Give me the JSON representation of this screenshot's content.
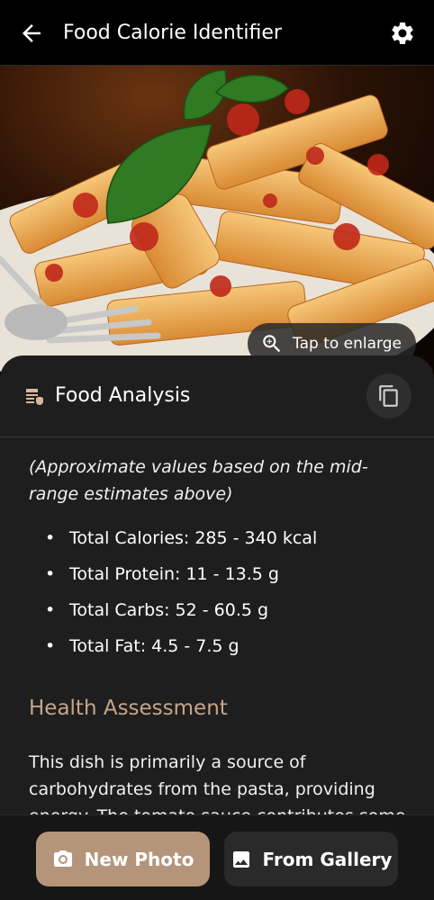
{
  "appbar": {
    "title": "Food Calorie Identifier",
    "back_icon": "arrow-left-icon",
    "settings_icon": "gear-icon"
  },
  "photo": {
    "enlarge_label": "Tap to enlarge",
    "enlarge_icon": "zoom-in-icon"
  },
  "analysis": {
    "heading": "Food Analysis",
    "heading_icon": "document-list-icon",
    "copy_icon": "copy-icon",
    "note": "(Approximate values based on the mid-range estimates above)",
    "totals": [
      "Total Calories: 285 - 340 kcal",
      "Total Protein: 11 - 13.5 g",
      "Total Carbs: 52 - 60.5 g",
      "Total Fat: 4.5 - 7.5 g"
    ],
    "health_title": "Health Assessment",
    "health_text": "This dish is primarily a source of carbohydrates from the pasta, providing energy. The tomato sauce contributes some"
  },
  "actions": {
    "new_photo_label": "New Photo",
    "new_photo_icon": "camera-icon",
    "gallery_label": "From Gallery",
    "gallery_icon": "image-icon"
  },
  "colors": {
    "accent": "#b59579",
    "section_title": "#c7a589",
    "card_bg": "#1e1e1e"
  }
}
